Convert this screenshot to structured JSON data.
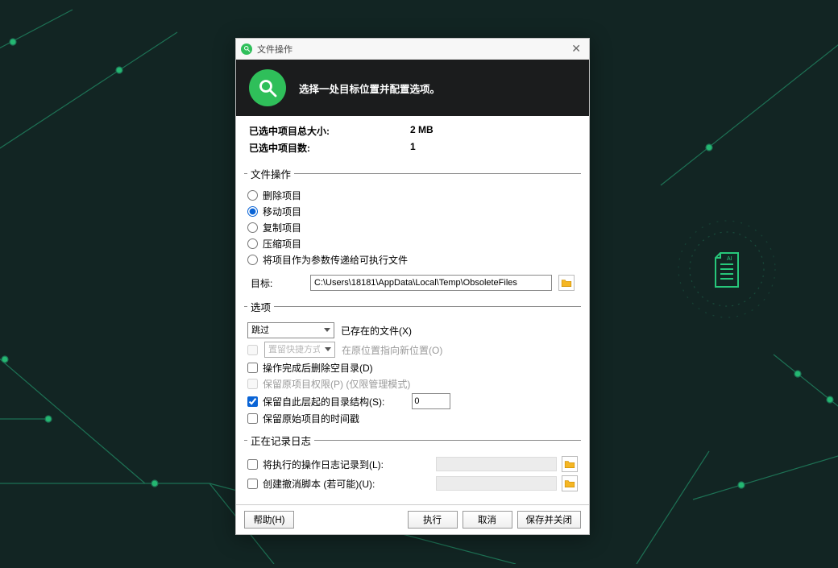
{
  "title": "文件操作",
  "header_text": "选择一处目标位置并配置选项。",
  "summary": {
    "size_label": "已选中项目总大小:",
    "size_value": "2 MB",
    "count_label": "已选中项目数:",
    "count_value": "1"
  },
  "ops": {
    "legend": "文件操作",
    "delete": "删除项目",
    "move": "移动项目",
    "copy": "复制项目",
    "compress": "压缩项目",
    "pass": "将项目作为参数传递给可执行文件"
  },
  "target": {
    "label": "目标:",
    "value": "C:\\Users\\18181\\AppData\\Local\\Temp\\ObsoleteFiles"
  },
  "options": {
    "legend": "选项",
    "skip_selected": "跳过",
    "existing_label": "已存在的文件(X)",
    "shortcut_selected": "置留快捷方式",
    "origloc_label": "在原位置指向新位置(O)",
    "del_empty": "操作完成后删除空目录(D)",
    "keep_perm": "保留原项目权限(P) (仅限管理模式)",
    "keep_struct": "保留自此层起的目录结构(S):",
    "level_value": "0",
    "keep_time": "保留原始项目的时间戳"
  },
  "logging": {
    "legend": "正在记录日志",
    "log_ops": "将执行的操作日志记录到(L):",
    "undo": "创建撤消脚本 (若可能)(U):"
  },
  "buttons": {
    "help": "帮助(H)",
    "run": "执行",
    "cancel": "取消",
    "save_close": "保存并关闭"
  },
  "icons": {
    "search": "search-icon",
    "close": "close-icon",
    "folder": "folder-icon"
  }
}
